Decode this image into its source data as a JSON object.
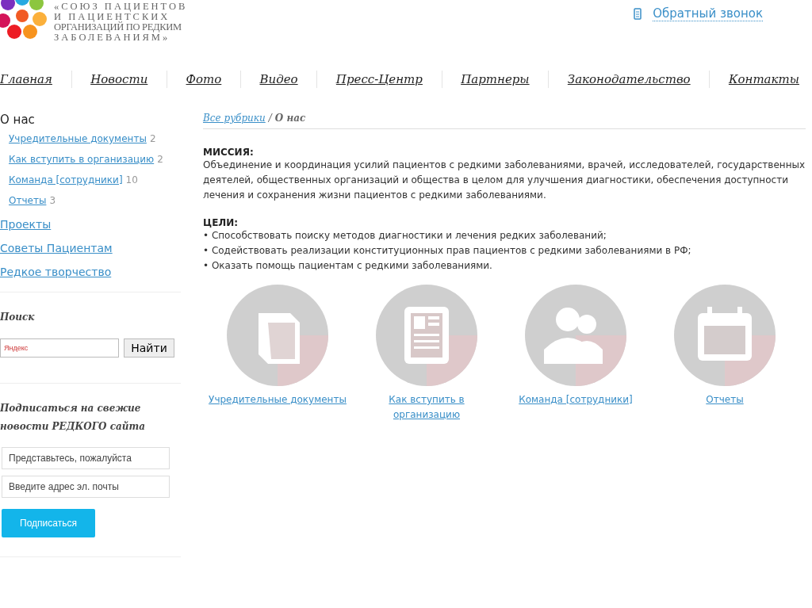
{
  "logo": {
    "lines": [
      "«СОЮЗ ПАЦИЕНТОВ",
      "И ПАЦИЕНТСКИХ",
      "ОРГАНИЗАЦИЙ ПО РЕДКИМ",
      "ЗАБОЛЕВАНИЯМ»"
    ]
  },
  "callback": {
    "label": "Обратный звонок"
  },
  "nav": [
    "Главная",
    "Новости",
    "Фото",
    "Видео",
    "Пресс-Центр",
    "Партнеры",
    "Законодательство",
    "Контакты"
  ],
  "sidebar": {
    "title": "О нас",
    "subitems": [
      {
        "label": "Учредительные документы",
        "count": "2"
      },
      {
        "label": "Как вступить в организацию",
        "count": "2"
      },
      {
        "label": "Команда [сотрудники]",
        "count": "10"
      },
      {
        "label": "Отчеты",
        "count": "3"
      }
    ],
    "links": [
      "Проекты",
      "Советы Пациентам",
      "Редкое творчество"
    ],
    "search": {
      "heading": "Поиск",
      "placeholder": "Яндекс",
      "button": "Найти"
    },
    "subscribe": {
      "heading": "Подписаться на свежие новости РЕДКОГО сайта",
      "name_placeholder": "Представьтесь, пожалуйста",
      "email_placeholder": "Введите адрес эл. почты",
      "button": "Подписаться"
    }
  },
  "breadcrumb": {
    "link": "Все рубрики",
    "separator": "/",
    "current": "О нас"
  },
  "mission": {
    "heading": "МИССИЯ:",
    "text": "Объединение и координация усилий пациентов с редкими заболеваниями, врачей, исследователей, государственных деятелей, общественных организаций и общества в целом для улучшения диагностики, обеспечения доступности лечения и сохранения жизни пациентов с редкими заболеваниями."
  },
  "goals": {
    "heading": "ЦЕЛИ:",
    "items": [
      "• Способствовать поиску методов диагностики и лечения редких заболеваний;",
      "• Содействовать реализации конституционных прав пациентов с редкими заболеваниями в РФ;",
      "• Оказать помощь пациентам с редкими заболеваниями."
    ]
  },
  "tiles": [
    {
      "kind": "book",
      "label": "Учредительные документы"
    },
    {
      "kind": "form",
      "label": "Как вступить в организацию"
    },
    {
      "kind": "people",
      "label": "Команда [сотрудники]"
    },
    {
      "kind": "calendar",
      "label": "Отчеты"
    }
  ]
}
